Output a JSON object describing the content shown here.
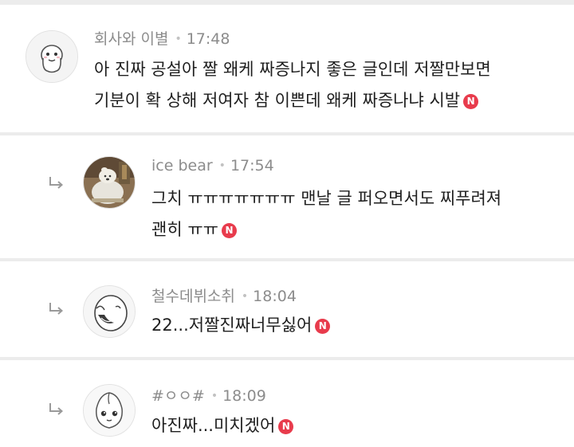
{
  "comments": [
    {
      "author": "회사와 이별",
      "time": "17:48",
      "lines": [
        "아 진짜 공설아 짤 왜케 짜증나지 좋은 글인데 저짤만보면",
        "기분이 확 상해 저여자 참 이쁜데 왜케 짜증나냐 시발"
      ],
      "badge": "N",
      "is_reply": false
    },
    {
      "author": "ice bear",
      "time": "17:54",
      "lines": [
        "그치 ㅠㅠㅠㅠㅠㅠㅠ 맨날 글 퍼오면서도 찌푸려져",
        "괜히 ㅠㅠ"
      ],
      "badge": "N",
      "is_reply": true
    },
    {
      "author": "철수데뷔소취",
      "time": "18:04",
      "lines": [
        "22...저짤진짜너무싫어"
      ],
      "badge": "N",
      "is_reply": true
    },
    {
      "author": "#ㅇㅇ#",
      "time": "18:09",
      "lines": [
        "아진짜...미치겠어"
      ],
      "badge": "N",
      "is_reply": true
    }
  ],
  "icons": {
    "reply": "reply-arrow-icon",
    "new": "new-badge-icon"
  },
  "colors": {
    "background": "#ececec",
    "card": "#ffffff",
    "meta_text": "#8c8c8c",
    "badge": "#e83b4c"
  }
}
